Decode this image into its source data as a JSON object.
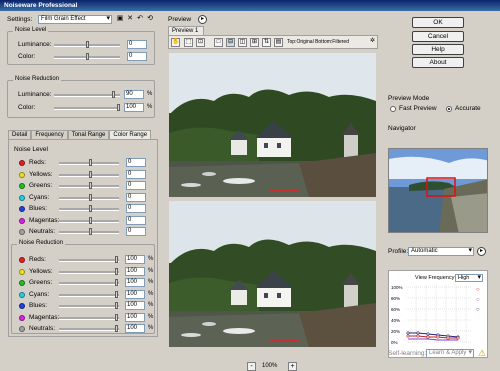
{
  "app": {
    "title": "Noiseware Professional"
  },
  "settings": {
    "label": "Settings:",
    "value": "Film Grain Effect"
  },
  "noise_level": {
    "title": "Noise Level",
    "rows": [
      {
        "label": "Luminance:",
        "value": "0",
        "level": 0.5
      },
      {
        "label": "Color:",
        "value": "0",
        "level": 0.5
      }
    ]
  },
  "noise_reduction": {
    "title": "Noise Reduction",
    "rows": [
      {
        "label": "Luminance:",
        "value": "90",
        "unit": "%",
        "level": 0.9
      },
      {
        "label": "Color:",
        "value": "100",
        "unit": "%",
        "level": 1.0
      }
    ]
  },
  "tabs": [
    "Detail",
    "Frequency",
    "Tonal Range",
    "Color Range"
  ],
  "color_range": {
    "noise_level_title": "Noise Level",
    "noise_reduction_title": "Noise Reduction",
    "level_rows": [
      {
        "label": "Reds:",
        "value": "0",
        "color": "#e02020"
      },
      {
        "label": "Yellows:",
        "value": "0",
        "color": "#f0e020"
      },
      {
        "label": "Greens:",
        "value": "0",
        "color": "#20c020"
      },
      {
        "label": "Cyans:",
        "value": "0",
        "color": "#20d0e0"
      },
      {
        "label": "Blues:",
        "value": "0",
        "color": "#2040e0"
      },
      {
        "label": "Magentas:",
        "value": "0",
        "color": "#e020e0"
      },
      {
        "label": "Neutrals:",
        "value": "0",
        "color": "#a0a0a0"
      }
    ],
    "reduction_rows": [
      {
        "label": "Reds:",
        "value": "100",
        "unit": "%",
        "color": "#e02020"
      },
      {
        "label": "Yellows:",
        "value": "100",
        "unit": "%",
        "color": "#f0e020"
      },
      {
        "label": "Greens:",
        "value": "100",
        "unit": "%",
        "color": "#20c020"
      },
      {
        "label": "Cyans:",
        "value": "100",
        "unit": "%",
        "color": "#20d0e0"
      },
      {
        "label": "Blues:",
        "value": "100",
        "unit": "%",
        "color": "#2040e0"
      },
      {
        "label": "Magentas:",
        "value": "100",
        "unit": "%",
        "color": "#e020e0"
      },
      {
        "label": "Neutrals:",
        "value": "100",
        "unit": "%",
        "color": "#a0a0a0"
      }
    ]
  },
  "preview": {
    "header": "Preview",
    "tab": "Preview 1",
    "layout_text": "Top:Original Bottom:Filtered",
    "zoom": "100%",
    "zoom_minus": "-",
    "zoom_plus": "+"
  },
  "buttons": {
    "ok": "OK",
    "cancel": "Cancel",
    "help": "Help",
    "about": "About"
  },
  "preview_mode": {
    "title": "Preview Mode",
    "fast": "Fast Preview",
    "accurate": "Accurate",
    "selected": "accurate"
  },
  "navigator": {
    "title": "Navigator"
  },
  "profile": {
    "label": "Profile:",
    "value": "Automatic",
    "view_frequency_label": "View Frequency:",
    "view_frequency_value": "High",
    "ticks": [
      "100%",
      "80%",
      "60%",
      "40%",
      "20%",
      "0%"
    ]
  },
  "self_learning": {
    "label": "Self-learning:",
    "value": "Learn & Apply"
  }
}
